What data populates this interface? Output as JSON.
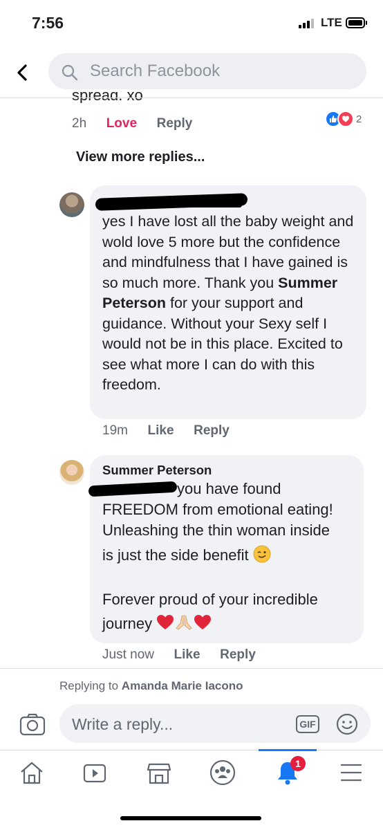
{
  "status_bar": {
    "time": "7:56",
    "network": "LTE"
  },
  "search": {
    "placeholder": "Search Facebook"
  },
  "previous_comment": {
    "text_fragment": "spread. xo",
    "time": "2h",
    "love_label": "Love",
    "reply_label": "Reply",
    "reaction_count": "2"
  },
  "view_more_replies": "View more replies...",
  "comment1": {
    "text_before": "yes I have lost all the baby weight and wold love 5 more but the confidence and mindfulness that I have gained is so much more. Thank you ",
    "mention": "Summer Peterson",
    "text_after": " for your support and guidance. Without your Sexy self I would not be in this place.  Excited to see what more I can do with this freedom.",
    "time": "19m",
    "like_label": "Like",
    "reply_label": "Reply"
  },
  "comment2": {
    "author": "Summer Peterson",
    "line1": "you have found",
    "line2": "FREEDOM from emotional eating!",
    "line3": "Unleashing the thin woman inside",
    "line4": "is just the side benefit",
    "line5": "Forever proud of your incredible",
    "line6": "journey",
    "time": "Just now",
    "like_label": "Like",
    "reply_label": "Reply"
  },
  "composer": {
    "replying_prefix": "Replying to",
    "replying_to": "Amanda Marie Iacono",
    "placeholder": "Write a reply...",
    "gif_label": "GIF"
  },
  "tab_bar": {
    "notification_count": "1"
  },
  "colors": {
    "accent": "#1877f2",
    "love": "#e0245e",
    "badge": "#e41e3f"
  }
}
